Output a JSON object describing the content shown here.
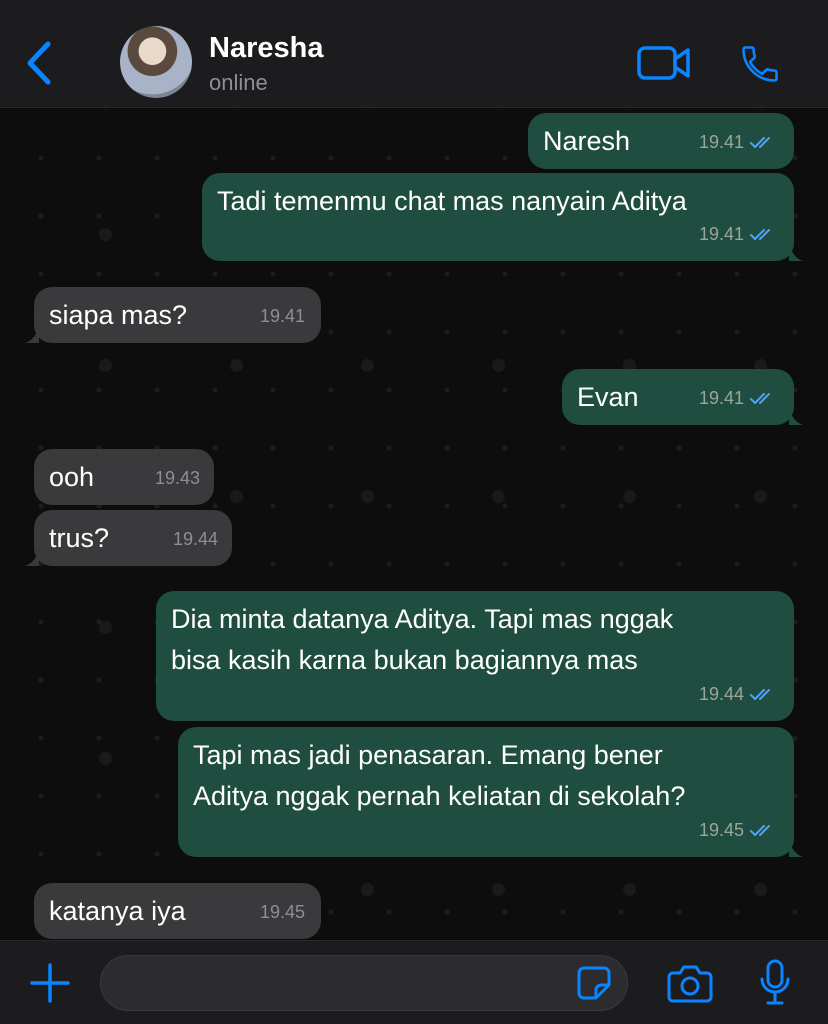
{
  "header": {
    "contact_name": "Naresha",
    "status": "online",
    "back_icon": "chevron-left-icon",
    "video_icon": "video-camera-icon",
    "call_icon": "phone-icon",
    "accent_color": "#0a84ff"
  },
  "messages": [
    {
      "direction": "out",
      "text": "Naresh",
      "time": "19.41",
      "read": true
    },
    {
      "direction": "out",
      "text": "Tadi temenmu chat mas nanyain Aditya",
      "time": "19.41",
      "read": true
    },
    {
      "direction": "in",
      "text": "siapa mas?",
      "time": "19.41"
    },
    {
      "direction": "out",
      "text": "Evan",
      "time": "19.41",
      "read": true
    },
    {
      "direction": "in",
      "text": "ooh",
      "time": "19.43"
    },
    {
      "direction": "in",
      "text": "trus?",
      "time": "19.44"
    },
    {
      "direction": "out",
      "text": "Dia minta datanya Aditya. Tapi mas nggak\nbisa kasih karna bukan bagiannya mas",
      "time": "19.44",
      "read": true
    },
    {
      "direction": "out",
      "text": "Tapi mas jadi penasaran. Emang bener\nAditya nggak pernah keliatan di sekolah?",
      "time": "19.45",
      "read": true
    },
    {
      "direction": "in",
      "text": "katanya iya",
      "time": "19.45"
    }
  ],
  "footer": {
    "input_value": "",
    "add_icon": "plus-icon",
    "sticker_icon": "sticker-icon",
    "camera_icon": "camera-icon",
    "mic_icon": "microphone-icon"
  },
  "colors": {
    "outgoing_bubble": "#1f4d3f",
    "incoming_bubble": "#3a3a3c",
    "read_ticks": "#4fa3ff"
  }
}
